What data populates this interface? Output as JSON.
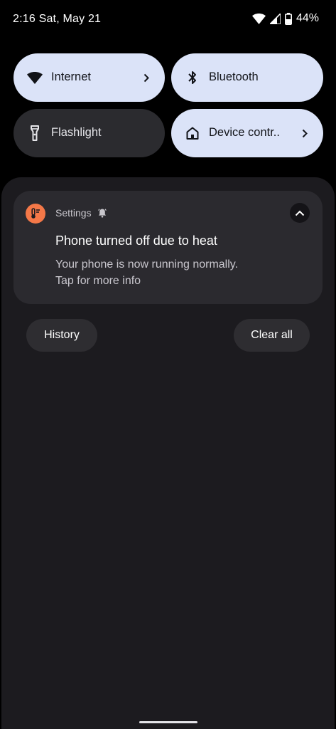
{
  "status_bar": {
    "time_date": "2:16 Sat, May 21",
    "battery_percent": "44%",
    "icons": [
      "wifi-icon",
      "cell-signal-icon",
      "battery-icon"
    ]
  },
  "quick_settings": {
    "tiles": [
      {
        "label": "Internet",
        "icon": "wifi-icon",
        "state": "on",
        "has_chevron": true
      },
      {
        "label": "Bluetooth",
        "icon": "bluetooth-icon",
        "state": "on",
        "has_chevron": false
      },
      {
        "label": "Flashlight",
        "icon": "flashlight-icon",
        "state": "off",
        "has_chevron": false
      },
      {
        "label": "Device contr..",
        "icon": "home-icon",
        "state": "on",
        "has_chevron": true
      }
    ]
  },
  "notification": {
    "app_name": "Settings",
    "app_icon": "thermometer-icon",
    "alert_icon": "bell-icon",
    "title": "Phone turned off due to heat",
    "body_line1": "Your phone is now running normally.",
    "body_line2": "Tap for more info"
  },
  "actions": {
    "history_label": "History",
    "clear_all_label": "Clear all"
  },
  "colors": {
    "tile_on": "#dbe3f8",
    "tile_off": "#2b2b2f",
    "shade_bg": "#1c1b1f",
    "card_bg": "#2b2a2f",
    "app_icon_bg": "#f47848"
  }
}
